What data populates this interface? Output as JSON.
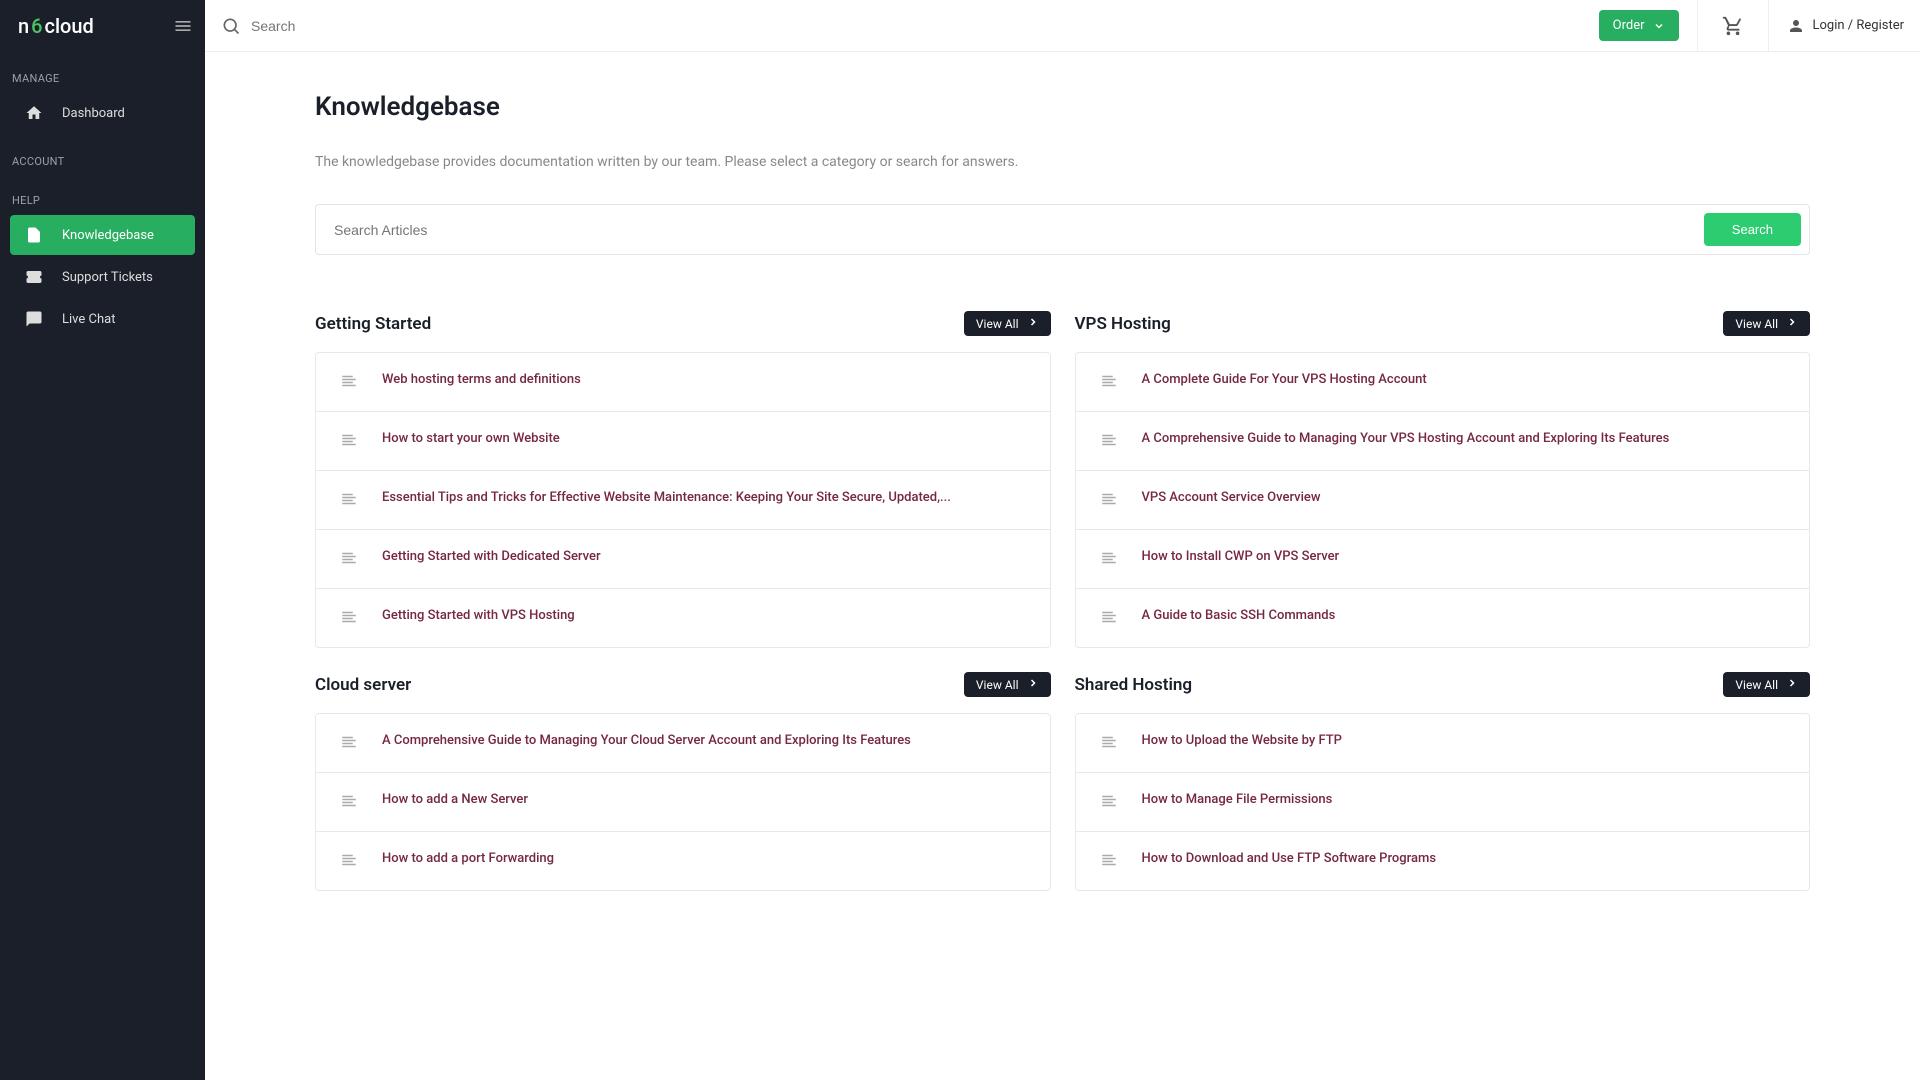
{
  "brand": {
    "pre": "n",
    "mid": "6",
    "post": "cloud"
  },
  "topbar": {
    "search_placeholder": "Search",
    "order_label": "Order",
    "login_label": "Login / Register"
  },
  "sidebar": {
    "sections": [
      {
        "label": "MANAGE",
        "items": [
          {
            "id": "dashboard",
            "label": "Dashboard",
            "icon": "home"
          }
        ]
      },
      {
        "label": "ACCOUNT",
        "items": []
      },
      {
        "label": "HELP",
        "items": [
          {
            "id": "knowledgebase",
            "label": "Knowledgebase",
            "icon": "doc",
            "active": true
          },
          {
            "id": "support-tickets",
            "label": "Support Tickets",
            "icon": "ticket"
          },
          {
            "id": "live-chat",
            "label": "Live Chat",
            "icon": "chat"
          }
        ]
      }
    ]
  },
  "page": {
    "title": "Knowledgebase",
    "description": "The knowledgebase provides documentation written by our team. Please select a category or search for answers.",
    "search_placeholder": "Search Articles",
    "search_button": "Search",
    "view_all_label": "View All"
  },
  "categories": [
    {
      "title": "Getting Started",
      "articles": [
        "Web hosting terms and definitions",
        "How to start your own Website",
        "Essential Tips and Tricks for Effective Website Maintenance: Keeping Your Site Secure, Updated,...",
        "Getting Started with Dedicated Server",
        "Getting Started with VPS Hosting"
      ]
    },
    {
      "title": "VPS Hosting",
      "articles": [
        "A Complete Guide For Your VPS Hosting Account",
        "A Comprehensive Guide to Managing Your VPS Hosting Account and Exploring Its Features",
        "VPS Account Service Overview",
        "How to Install CWP on VPS Server",
        "A Guide to Basic SSH Commands"
      ]
    },
    {
      "title": "Cloud server",
      "articles": [
        "A Comprehensive Guide to Managing Your Cloud Server Account and Exploring Its Features",
        "How to add a New Server",
        "How to add a port Forwarding"
      ]
    },
    {
      "title": "Shared Hosting",
      "articles": [
        "How to Upload the Website by FTP",
        "How to Manage File Permissions",
        "How to Download and Use FTP Software Programs"
      ]
    }
  ]
}
